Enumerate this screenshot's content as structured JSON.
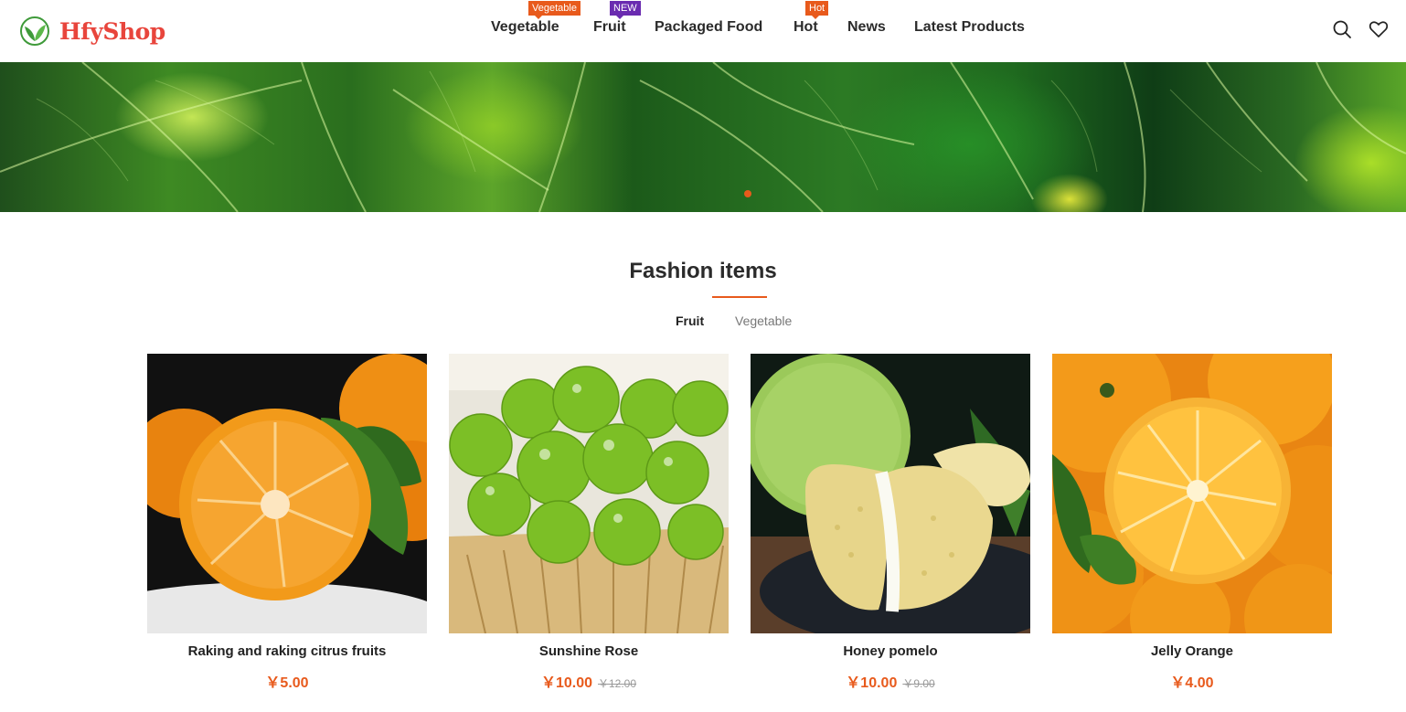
{
  "brand": {
    "name": "HfyShop",
    "color": "#e8453c",
    "icon": "leaf-logo-icon"
  },
  "nav": {
    "items": [
      {
        "label": "Vegetable",
        "badge": "Vegetable",
        "badge_color": "#e85a1c"
      },
      {
        "label": "Fruit",
        "badge": "NEW",
        "badge_color": "#6a2bb0"
      },
      {
        "label": "Packaged Food"
      },
      {
        "label": "Hot",
        "badge": "Hot",
        "badge_color": "#e85a1c"
      },
      {
        "label": "News"
      },
      {
        "label": "Latest Products"
      }
    ],
    "icons": [
      "search-icon",
      "heart-icon"
    ]
  },
  "banner": {
    "slide_count": 1,
    "active_slide": 1
  },
  "section": {
    "title": "Fashion items",
    "tabs": [
      {
        "label": "Fruit",
        "active": true
      },
      {
        "label": "Vegetable",
        "active": false
      }
    ]
  },
  "products": [
    {
      "name": "Raking and raking citrus fruits",
      "price": "￥5.00",
      "old_price": ""
    },
    {
      "name": "Sunshine Rose",
      "price": "￥10.00",
      "old_price": "￥12.00"
    },
    {
      "name": "Honey pomelo",
      "price": "￥10.00",
      "old_price": "￥9.00"
    },
    {
      "name": "Jelly Orange",
      "price": "￥4.00",
      "old_price": ""
    }
  ],
  "colors": {
    "accent": "#e85a1c",
    "badge_purple": "#6a2bb0",
    "text": "#2b2b2b"
  }
}
